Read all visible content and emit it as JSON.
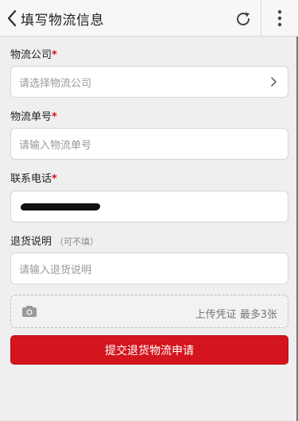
{
  "header": {
    "title": "填写物流信息"
  },
  "form": {
    "company": {
      "label": "物流公司",
      "required_mark": "*",
      "placeholder": "请选择物流公司"
    },
    "tracking": {
      "label": "物流单号",
      "required_mark": "*",
      "placeholder": "请输入物流单号"
    },
    "phone": {
      "label": "联系电话",
      "required_mark": "*"
    },
    "note": {
      "label": "退货说明",
      "optional": "（可不填）",
      "placeholder": "请输入退货说明"
    },
    "upload": {
      "text": "上传凭证 最多3张"
    },
    "submit_label": "提交退货物流申请"
  },
  "colors": {
    "accent": "#d4151e"
  }
}
